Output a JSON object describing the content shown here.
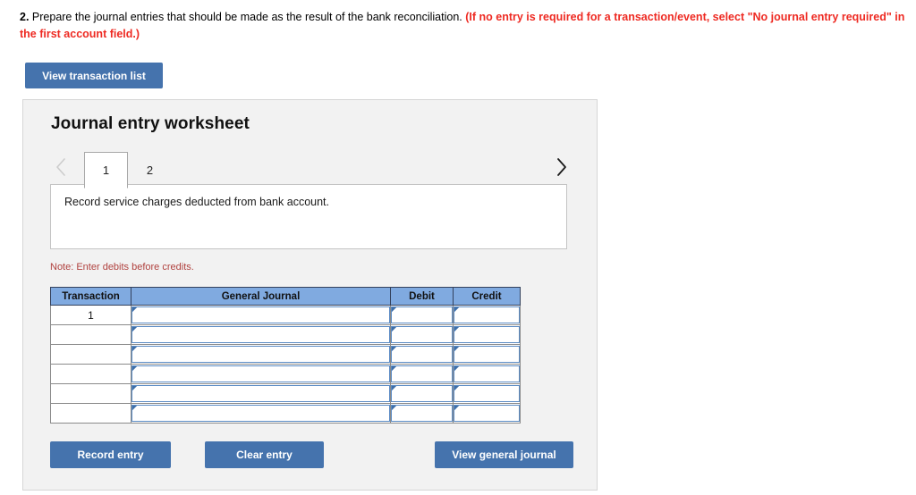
{
  "prompt": {
    "number": "2.",
    "black_text": " Prepare the journal entries that should be made as the result of the bank reconciliation. ",
    "red_text": "(If no entry is required for a transaction/event, select \"No journal entry required\" in the first account field.)"
  },
  "toolbar": {
    "view_transaction_list_label": "View transaction list"
  },
  "panel": {
    "title": "Journal entry worksheet",
    "tabs": [
      {
        "label": "1",
        "active": true
      },
      {
        "label": "2",
        "active": false
      }
    ],
    "prev_icon": "chevron-left-icon",
    "next_icon": "chevron-right-icon",
    "description": "Record service charges deducted from bank account.",
    "note": "Note: Enter debits before credits."
  },
  "table": {
    "headers": [
      "Transaction",
      "General Journal",
      "Debit",
      "Credit"
    ],
    "rows": [
      {
        "transaction": "1",
        "general_journal": "",
        "debit": "",
        "credit": ""
      },
      {
        "transaction": "",
        "general_journal": "",
        "debit": "",
        "credit": ""
      },
      {
        "transaction": "",
        "general_journal": "",
        "debit": "",
        "credit": ""
      },
      {
        "transaction": "",
        "general_journal": "",
        "debit": "",
        "credit": ""
      },
      {
        "transaction": "",
        "general_journal": "",
        "debit": "",
        "credit": ""
      },
      {
        "transaction": "",
        "general_journal": "",
        "debit": "",
        "credit": ""
      }
    ]
  },
  "footer": {
    "record_entry_label": "Record entry",
    "clear_entry_label": "Clear entry",
    "view_general_journal_label": "View general journal"
  },
  "colors": {
    "button_blue": "#4573ad",
    "table_header_blue": "#80aae0",
    "panel_background": "#f2f2f2",
    "note_red": "#b0413e",
    "prompt_red": "#ee2a22",
    "field_border_blue": "#5b8bc4"
  }
}
